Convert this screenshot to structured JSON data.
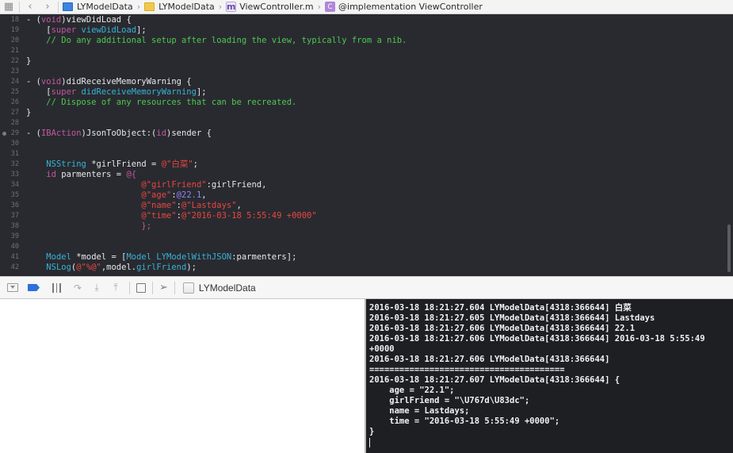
{
  "jumpbar": {
    "crumbs": [
      "LYModelData",
      "LYModelData",
      "ViewController.m",
      "@implementation ViewController"
    ],
    "file_badge": "m",
    "class_badge": "C"
  },
  "editor": {
    "lines": [
      {
        "n": "18",
        "segs": [
          [
            "pl",
            "- ("
          ],
          [
            "kw",
            "void"
          ],
          [
            "pl",
            ")viewDidLoad {"
          ]
        ]
      },
      {
        "n": "19",
        "segs": [
          [
            "pl",
            "    ["
          ],
          [
            "kw",
            "super"
          ],
          [
            "pl",
            " "
          ],
          [
            "ty",
            "viewDidLoad"
          ],
          [
            "pl",
            "];"
          ]
        ]
      },
      {
        "n": "20",
        "segs": [
          [
            "cm",
            "    // Do any additional setup after loading the view, typically from a nib."
          ]
        ]
      },
      {
        "n": "21",
        "segs": []
      },
      {
        "n": "22",
        "segs": [
          [
            "pl",
            "}"
          ]
        ]
      },
      {
        "n": "23",
        "segs": []
      },
      {
        "n": "24",
        "segs": [
          [
            "pl",
            "- ("
          ],
          [
            "kw",
            "void"
          ],
          [
            "pl",
            ")didReceiveMemoryWarning {"
          ]
        ]
      },
      {
        "n": "25",
        "segs": [
          [
            "pl",
            "    ["
          ],
          [
            "kw",
            "super"
          ],
          [
            "pl",
            " "
          ],
          [
            "ty",
            "didReceiveMemoryWarning"
          ],
          [
            "pl",
            "];"
          ]
        ]
      },
      {
        "n": "26",
        "segs": [
          [
            "cm",
            "    // Dispose of any resources that can be recreated."
          ]
        ]
      },
      {
        "n": "27",
        "segs": [
          [
            "pl",
            "}"
          ]
        ]
      },
      {
        "n": "28",
        "segs": []
      },
      {
        "n": "29",
        "bp": true,
        "segs": [
          [
            "pl",
            "- ("
          ],
          [
            "kw",
            "IBAction"
          ],
          [
            "pl",
            ")JsonToObject:("
          ],
          [
            "kw",
            "id"
          ],
          [
            "pl",
            ")sender {"
          ]
        ]
      },
      {
        "n": "30",
        "segs": []
      },
      {
        "n": "31",
        "segs": []
      },
      {
        "n": "32",
        "segs": [
          [
            "pl",
            "    "
          ],
          [
            "ty",
            "NSString"
          ],
          [
            "pl",
            " *girlFriend = "
          ],
          [
            "st",
            "@\"白菜\""
          ],
          [
            "pl",
            ";"
          ]
        ]
      },
      {
        "n": "33",
        "segs": [
          [
            "pl",
            "    "
          ],
          [
            "kw",
            "id"
          ],
          [
            "pl",
            " parmenters = "
          ],
          [
            "kw",
            "@{"
          ]
        ]
      },
      {
        "n": "34",
        "segs": [
          [
            "pl",
            "                       "
          ],
          [
            "st",
            "@\"girlFriend\""
          ],
          [
            "pl",
            ":girlFriend,"
          ]
        ]
      },
      {
        "n": "35",
        "segs": [
          [
            "pl",
            "                       "
          ],
          [
            "st",
            "@\"age\""
          ],
          [
            "pl",
            ":"
          ],
          [
            "nu",
            "@22.1"
          ],
          [
            "pl",
            ","
          ]
        ]
      },
      {
        "n": "36",
        "segs": [
          [
            "pl",
            "                       "
          ],
          [
            "st",
            "@\"name\""
          ],
          [
            "pl",
            ":"
          ],
          [
            "st",
            "@\"Lastdays\""
          ],
          [
            "pl",
            ","
          ]
        ]
      },
      {
        "n": "37",
        "segs": [
          [
            "pl",
            "                       "
          ],
          [
            "st",
            "@\"time\""
          ],
          [
            "pl",
            ":"
          ],
          [
            "st",
            "@\"2016-03-18 5:55:49 +0000\""
          ]
        ]
      },
      {
        "n": "38",
        "segs": [
          [
            "pl",
            "                       "
          ],
          [
            "kw",
            "};"
          ]
        ]
      },
      {
        "n": "39",
        "segs": []
      },
      {
        "n": "40",
        "segs": []
      },
      {
        "n": "41",
        "segs": [
          [
            "pl",
            "    "
          ],
          [
            "ty",
            "Model"
          ],
          [
            "pl",
            " *model = ["
          ],
          [
            "ty",
            "Model"
          ],
          [
            "pl",
            " "
          ],
          [
            "ty",
            "LYModelWithJSON"
          ],
          [
            "pl",
            ":parmenters];"
          ]
        ]
      },
      {
        "n": "42",
        "segs": [
          [
            "pl",
            "    "
          ],
          [
            "ty",
            "NSLog"
          ],
          [
            "pl",
            "("
          ],
          [
            "st",
            "@\"%@\""
          ],
          [
            "pl",
            ",model."
          ],
          [
            "ty",
            "girlFriend"
          ],
          [
            "pl",
            ");"
          ]
        ]
      }
    ]
  },
  "debugbar": {
    "target_label": "LYModelData"
  },
  "console": {
    "lines": [
      "2016-03-18 18:21:27.604 LYModelData[4318:366644] 白菜",
      "2016-03-18 18:21:27.605 LYModelData[4318:366644] Lastdays",
      "2016-03-18 18:21:27.606 LYModelData[4318:366644] 22.1",
      "2016-03-18 18:21:27.606 LYModelData[4318:366644] 2016-03-18 5:55:49",
      "+0000",
      "2016-03-18 18:21:27.606 LYModelData[4318:366644]",
      "=======================================",
      "2016-03-18 18:21:27.607 LYModelData[4318:366644] {",
      "    age = \"22.1\";",
      "    girlFriend = \"\\U767d\\U83dc\";",
      "    name = Lastdays;",
      "    time = \"2016-03-18 5:55:49 +0000\";",
      "}"
    ]
  }
}
